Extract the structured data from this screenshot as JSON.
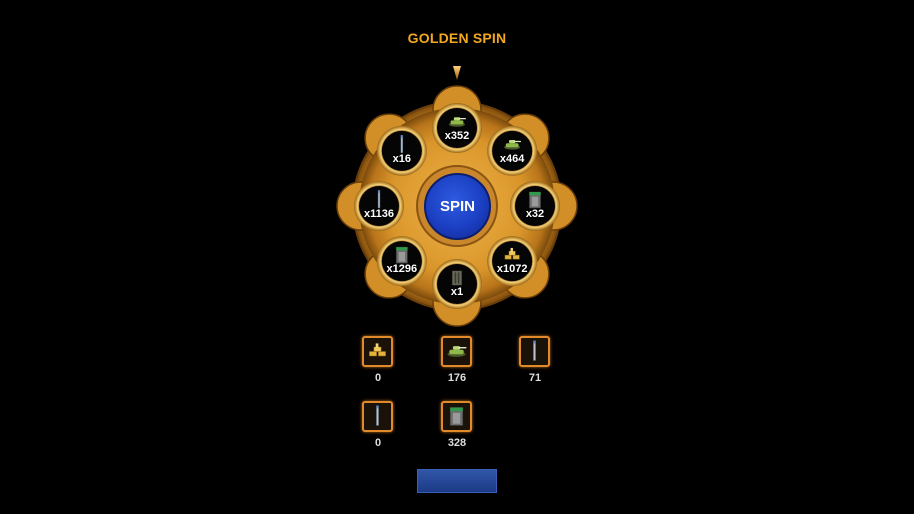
{
  "title": "GOLDEN SPIN",
  "spin_label": "SPIN",
  "bottom_button_label": "",
  "colors": {
    "title": "#f2a81e",
    "wheel_gold": "#d9952a",
    "spin_blue": "#1b3fc2",
    "box_border": "#e08a2a"
  },
  "wheel_slots": [
    {
      "label": "x352",
      "icon": "green-tank-icon"
    },
    {
      "label": "x464",
      "icon": "green-tank-icon"
    },
    {
      "label": "x32",
      "icon": "armor-plate-icon"
    },
    {
      "label": "x1072",
      "icon": "gold-bars-icon"
    },
    {
      "label": "x1",
      "icon": "soldier-icon"
    },
    {
      "label": "x1296",
      "icon": "armor-plate-icon"
    },
    {
      "label": "x1136",
      "icon": "antenna-rod-icon"
    },
    {
      "label": "x16",
      "icon": "antenna-rod-icon"
    }
  ],
  "inventory": [
    {
      "count": "0",
      "icon": "gold-bars-icon"
    },
    {
      "count": "176",
      "icon": "green-tank-icon"
    },
    {
      "count": "71",
      "icon": "antenna-rod-icon"
    },
    {
      "count": "0",
      "icon": "antenna-rod-icon"
    },
    {
      "count": "328",
      "icon": "armor-plate-icon"
    }
  ]
}
